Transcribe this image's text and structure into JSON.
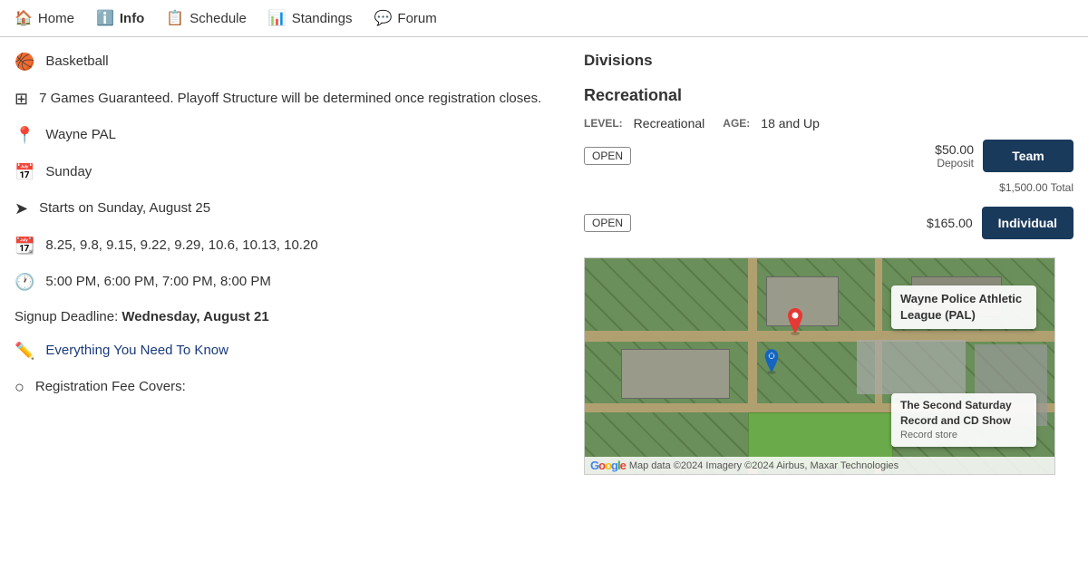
{
  "nav": {
    "items": [
      {
        "id": "home",
        "label": "Home",
        "icon": "🏠",
        "active": false
      },
      {
        "id": "info",
        "label": "Info",
        "icon": "ℹ️",
        "active": true
      },
      {
        "id": "schedule",
        "label": "Schedule",
        "icon": "📋",
        "active": false
      },
      {
        "id": "standings",
        "label": "Standings",
        "icon": "📊",
        "active": false
      },
      {
        "id": "forum",
        "label": "Forum",
        "icon": "💬",
        "active": false
      }
    ]
  },
  "left": {
    "sport": "Basketball",
    "games_info": "7 Games Guaranteed. Playoff Structure will be determined once registration closes.",
    "location": "Wayne PAL",
    "day": "Sunday",
    "starts": "Starts on Sunday, August 25",
    "dates": "8.25, 9.8, 9.15, 9.22, 9.29, 10.6, 10.13, 10.20",
    "times": "5:00 PM, 6:00 PM, 7:00 PM, 8:00 PM",
    "signup_prefix": "Signup Deadline: ",
    "signup_date": "Wednesday, August 21",
    "need_to_know": "Everything You Need To Know",
    "reg_fee": "Registration Fee Covers:"
  },
  "right": {
    "divisions_title": "Divisions",
    "division_name": "Recreational",
    "level_label": "LEVEL:",
    "level_value": "Recreational",
    "age_label": "AGE:",
    "age_value": "18 and Up",
    "open_badge": "OPEN",
    "team_deposit": "$50.00",
    "team_deposit_label": "Deposit",
    "team_button": "Team",
    "team_total": "$1,500.00 Total",
    "individual_price": "$165.00",
    "individual_button": "Individual",
    "map_label1": "Wayne Police Athletic League (PAL)",
    "map_label2": "The Second Saturday Record and CD Show",
    "map_label2_sub": "Record store",
    "google_credit": "Map data ©2024 Imagery ©2024 Airbus, Maxar Technologies"
  }
}
